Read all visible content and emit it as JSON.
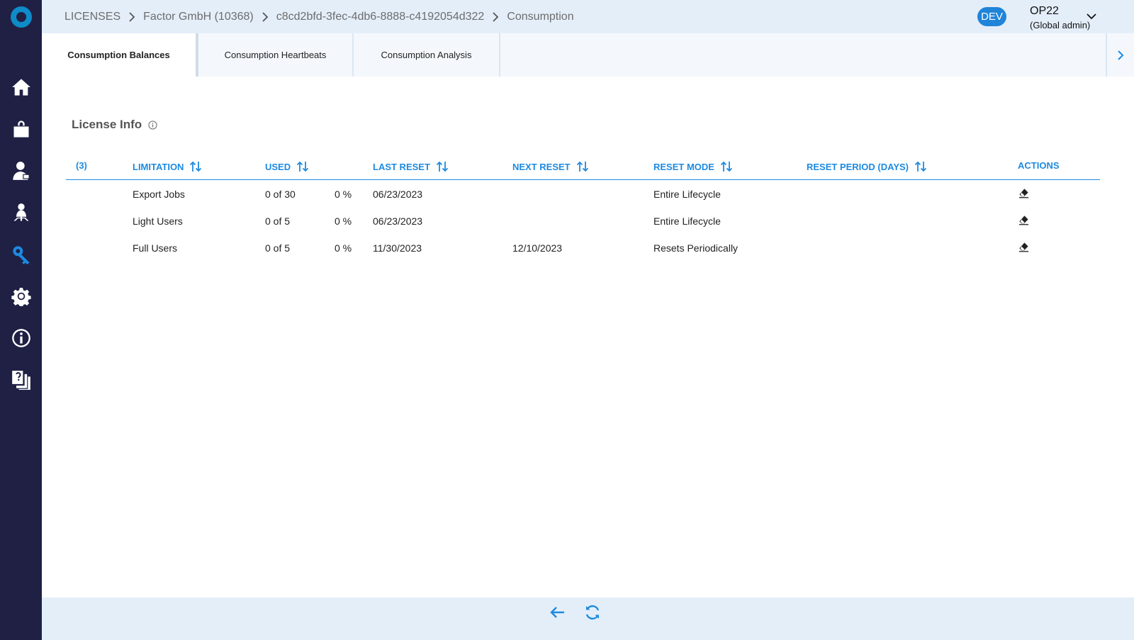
{
  "sidebar": {
    "items": [
      {
        "name": "home-icon",
        "active": false
      },
      {
        "name": "shopping-bag-icon",
        "active": false
      },
      {
        "name": "user-admin-icon",
        "active": false
      },
      {
        "name": "user-hierarchy-icon",
        "active": false
      },
      {
        "name": "key-icon",
        "active": true
      },
      {
        "name": "gear-icon",
        "active": false
      },
      {
        "name": "info-icon",
        "active": false
      },
      {
        "name": "documents-icon",
        "active": false
      }
    ]
  },
  "breadcrumb": [
    "LICENSES",
    "Factor GmbH (10368)",
    "c8cd2bfd-3fec-4db6-8888-c4192054d322",
    "Consumption"
  ],
  "header": {
    "env_badge": "DEV",
    "user_name": "OP22",
    "user_role": "(Global admin)"
  },
  "tabs": [
    "Consumption Balances",
    "Consumption Heartbeats",
    "Consumption Analysis"
  ],
  "section": {
    "title": "License Info"
  },
  "table": {
    "count": "(3)",
    "columns": [
      "LIMITATION",
      "USED",
      "LAST RESET",
      "NEXT RESET",
      "RESET MODE",
      "RESET PERIOD (DAYS)",
      "ACTIONS"
    ],
    "rows": [
      {
        "limitation": "Export Jobs",
        "used": "0 of 30",
        "percent": "0 %",
        "last_reset": "06/23/2023",
        "next_reset": "",
        "reset_mode": "Entire Lifecycle",
        "reset_period": ""
      },
      {
        "limitation": "Light Users",
        "used": "0 of 5",
        "percent": "0 %",
        "last_reset": "06/23/2023",
        "next_reset": "",
        "reset_mode": "Entire Lifecycle",
        "reset_period": ""
      },
      {
        "limitation": "Full Users",
        "used": "0 of 5",
        "percent": "0 %",
        "last_reset": "11/30/2023",
        "next_reset": "12/10/2023",
        "reset_mode": "Resets Periodically",
        "reset_period": ""
      }
    ]
  },
  "colors": {
    "sidebar_bg": "#1f2044",
    "accent": "#1d8ae0",
    "header_bg": "#e4eef9"
  }
}
